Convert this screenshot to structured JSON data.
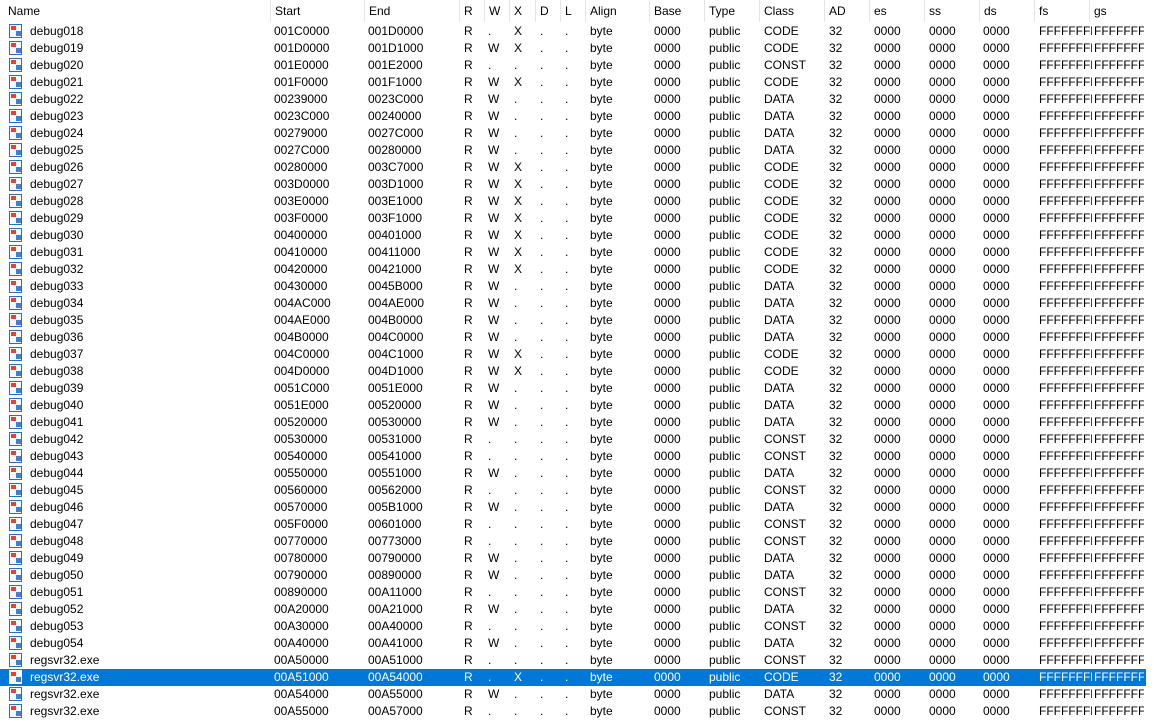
{
  "columns": [
    "Name",
    "Start",
    "End",
    "R",
    "W",
    "X",
    "D",
    "L",
    "Align",
    "Base",
    "Type",
    "Class",
    "AD",
    "es",
    "ss",
    "ds",
    "fs",
    "gs"
  ],
  "selected_index": 38,
  "colors": {
    "selection": "#0078d7",
    "icon_accent": "#e8402c"
  },
  "icons": {
    "segment": "segment-icon"
  },
  "rows": [
    [
      "debug018",
      "001C0000",
      "001D0000",
      "R",
      ".",
      "X",
      ".",
      ".",
      "byte",
      "0000",
      "public",
      "CODE",
      "32",
      "0000",
      "0000",
      "0000",
      "FFFFFFFF",
      "FFFFFFFF"
    ],
    [
      "debug019",
      "001D0000",
      "001D1000",
      "R",
      "W",
      "X",
      ".",
      ".",
      "byte",
      "0000",
      "public",
      "CODE",
      "32",
      "0000",
      "0000",
      "0000",
      "FFFFFFFF",
      "FFFFFFFF"
    ],
    [
      "debug020",
      "001E0000",
      "001E2000",
      "R",
      ".",
      ".",
      ".",
      ".",
      "byte",
      "0000",
      "public",
      "CONST",
      "32",
      "0000",
      "0000",
      "0000",
      "FFFFFFFF",
      "FFFFFFFF"
    ],
    [
      "debug021",
      "001F0000",
      "001F1000",
      "R",
      "W",
      "X",
      ".",
      ".",
      "byte",
      "0000",
      "public",
      "CODE",
      "32",
      "0000",
      "0000",
      "0000",
      "FFFFFFFF",
      "FFFFFFFF"
    ],
    [
      "debug022",
      "00239000",
      "0023C000",
      "R",
      "W",
      ".",
      ".",
      ".",
      "byte",
      "0000",
      "public",
      "DATA",
      "32",
      "0000",
      "0000",
      "0000",
      "FFFFFFFF",
      "FFFFFFFF"
    ],
    [
      "debug023",
      "0023C000",
      "00240000",
      "R",
      "W",
      ".",
      ".",
      ".",
      "byte",
      "0000",
      "public",
      "DATA",
      "32",
      "0000",
      "0000",
      "0000",
      "FFFFFFFF",
      "FFFFFFFF"
    ],
    [
      "debug024",
      "00279000",
      "0027C000",
      "R",
      "W",
      ".",
      ".",
      ".",
      "byte",
      "0000",
      "public",
      "DATA",
      "32",
      "0000",
      "0000",
      "0000",
      "FFFFFFFF",
      "FFFFFFFF"
    ],
    [
      "debug025",
      "0027C000",
      "00280000",
      "R",
      "W",
      ".",
      ".",
      ".",
      "byte",
      "0000",
      "public",
      "DATA",
      "32",
      "0000",
      "0000",
      "0000",
      "FFFFFFFF",
      "FFFFFFFF"
    ],
    [
      "debug026",
      "00280000",
      "003C7000",
      "R",
      "W",
      "X",
      ".",
      ".",
      "byte",
      "0000",
      "public",
      "CODE",
      "32",
      "0000",
      "0000",
      "0000",
      "FFFFFFFF",
      "FFFFFFFF"
    ],
    [
      "debug027",
      "003D0000",
      "003D1000",
      "R",
      "W",
      "X",
      ".",
      ".",
      "byte",
      "0000",
      "public",
      "CODE",
      "32",
      "0000",
      "0000",
      "0000",
      "FFFFFFFF",
      "FFFFFFFF"
    ],
    [
      "debug028",
      "003E0000",
      "003E1000",
      "R",
      "W",
      "X",
      ".",
      ".",
      "byte",
      "0000",
      "public",
      "CODE",
      "32",
      "0000",
      "0000",
      "0000",
      "FFFFFFFF",
      "FFFFFFFF"
    ],
    [
      "debug029",
      "003F0000",
      "003F1000",
      "R",
      "W",
      "X",
      ".",
      ".",
      "byte",
      "0000",
      "public",
      "CODE",
      "32",
      "0000",
      "0000",
      "0000",
      "FFFFFFFF",
      "FFFFFFFF"
    ],
    [
      "debug030",
      "00400000",
      "00401000",
      "R",
      "W",
      "X",
      ".",
      ".",
      "byte",
      "0000",
      "public",
      "CODE",
      "32",
      "0000",
      "0000",
      "0000",
      "FFFFFFFF",
      "FFFFFFFF"
    ],
    [
      "debug031",
      "00410000",
      "00411000",
      "R",
      "W",
      "X",
      ".",
      ".",
      "byte",
      "0000",
      "public",
      "CODE",
      "32",
      "0000",
      "0000",
      "0000",
      "FFFFFFFF",
      "FFFFFFFF"
    ],
    [
      "debug032",
      "00420000",
      "00421000",
      "R",
      "W",
      "X",
      ".",
      ".",
      "byte",
      "0000",
      "public",
      "CODE",
      "32",
      "0000",
      "0000",
      "0000",
      "FFFFFFFF",
      "FFFFFFFF"
    ],
    [
      "debug033",
      "00430000",
      "0045B000",
      "R",
      "W",
      ".",
      ".",
      ".",
      "byte",
      "0000",
      "public",
      "DATA",
      "32",
      "0000",
      "0000",
      "0000",
      "FFFFFFFF",
      "FFFFFFFF"
    ],
    [
      "debug034",
      "004AC000",
      "004AE000",
      "R",
      "W",
      ".",
      ".",
      ".",
      "byte",
      "0000",
      "public",
      "DATA",
      "32",
      "0000",
      "0000",
      "0000",
      "FFFFFFFF",
      "FFFFFFFF"
    ],
    [
      "debug035",
      "004AE000",
      "004B0000",
      "R",
      "W",
      ".",
      ".",
      ".",
      "byte",
      "0000",
      "public",
      "DATA",
      "32",
      "0000",
      "0000",
      "0000",
      "FFFFFFFF",
      "FFFFFFFF"
    ],
    [
      "debug036",
      "004B0000",
      "004C0000",
      "R",
      "W",
      ".",
      ".",
      ".",
      "byte",
      "0000",
      "public",
      "DATA",
      "32",
      "0000",
      "0000",
      "0000",
      "FFFFFFFF",
      "FFFFFFFF"
    ],
    [
      "debug037",
      "004C0000",
      "004C1000",
      "R",
      "W",
      "X",
      ".",
      ".",
      "byte",
      "0000",
      "public",
      "CODE",
      "32",
      "0000",
      "0000",
      "0000",
      "FFFFFFFF",
      "FFFFFFFF"
    ],
    [
      "debug038",
      "004D0000",
      "004D1000",
      "R",
      "W",
      "X",
      ".",
      ".",
      "byte",
      "0000",
      "public",
      "CODE",
      "32",
      "0000",
      "0000",
      "0000",
      "FFFFFFFF",
      "FFFFFFFF"
    ],
    [
      "debug039",
      "0051C000",
      "0051E000",
      "R",
      "W",
      ".",
      ".",
      ".",
      "byte",
      "0000",
      "public",
      "DATA",
      "32",
      "0000",
      "0000",
      "0000",
      "FFFFFFFF",
      "FFFFFFFF"
    ],
    [
      "debug040",
      "0051E000",
      "00520000",
      "R",
      "W",
      ".",
      ".",
      ".",
      "byte",
      "0000",
      "public",
      "DATA",
      "32",
      "0000",
      "0000",
      "0000",
      "FFFFFFFF",
      "FFFFFFFF"
    ],
    [
      "debug041",
      "00520000",
      "00530000",
      "R",
      "W",
      ".",
      ".",
      ".",
      "byte",
      "0000",
      "public",
      "DATA",
      "32",
      "0000",
      "0000",
      "0000",
      "FFFFFFFF",
      "FFFFFFFF"
    ],
    [
      "debug042",
      "00530000",
      "00531000",
      "R",
      ".",
      ".",
      ".",
      ".",
      "byte",
      "0000",
      "public",
      "CONST",
      "32",
      "0000",
      "0000",
      "0000",
      "FFFFFFFF",
      "FFFFFFFF"
    ],
    [
      "debug043",
      "00540000",
      "00541000",
      "R",
      ".",
      ".",
      ".",
      ".",
      "byte",
      "0000",
      "public",
      "CONST",
      "32",
      "0000",
      "0000",
      "0000",
      "FFFFFFFF",
      "FFFFFFFF"
    ],
    [
      "debug044",
      "00550000",
      "00551000",
      "R",
      "W",
      ".",
      ".",
      ".",
      "byte",
      "0000",
      "public",
      "DATA",
      "32",
      "0000",
      "0000",
      "0000",
      "FFFFFFFF",
      "FFFFFFFF"
    ],
    [
      "debug045",
      "00560000",
      "00562000",
      "R",
      ".",
      ".",
      ".",
      ".",
      "byte",
      "0000",
      "public",
      "CONST",
      "32",
      "0000",
      "0000",
      "0000",
      "FFFFFFFF",
      "FFFFFFFF"
    ],
    [
      "debug046",
      "00570000",
      "005B1000",
      "R",
      "W",
      ".",
      ".",
      ".",
      "byte",
      "0000",
      "public",
      "DATA",
      "32",
      "0000",
      "0000",
      "0000",
      "FFFFFFFF",
      "FFFFFFFF"
    ],
    [
      "debug047",
      "005F0000",
      "00601000",
      "R",
      ".",
      ".",
      ".",
      ".",
      "byte",
      "0000",
      "public",
      "CONST",
      "32",
      "0000",
      "0000",
      "0000",
      "FFFFFFFF",
      "FFFFFFFF"
    ],
    [
      "debug048",
      "00770000",
      "00773000",
      "R",
      ".",
      ".",
      ".",
      ".",
      "byte",
      "0000",
      "public",
      "CONST",
      "32",
      "0000",
      "0000",
      "0000",
      "FFFFFFFF",
      "FFFFFFFF"
    ],
    [
      "debug049",
      "00780000",
      "00790000",
      "R",
      "W",
      ".",
      ".",
      ".",
      "byte",
      "0000",
      "public",
      "DATA",
      "32",
      "0000",
      "0000",
      "0000",
      "FFFFFFFF",
      "FFFFFFFF"
    ],
    [
      "debug050",
      "00790000",
      "00890000",
      "R",
      "W",
      ".",
      ".",
      ".",
      "byte",
      "0000",
      "public",
      "DATA",
      "32",
      "0000",
      "0000",
      "0000",
      "FFFFFFFF",
      "FFFFFFFF"
    ],
    [
      "debug051",
      "00890000",
      "00A11000",
      "R",
      ".",
      ".",
      ".",
      ".",
      "byte",
      "0000",
      "public",
      "CONST",
      "32",
      "0000",
      "0000",
      "0000",
      "FFFFFFFF",
      "FFFFFFFF"
    ],
    [
      "debug052",
      "00A20000",
      "00A21000",
      "R",
      "W",
      ".",
      ".",
      ".",
      "byte",
      "0000",
      "public",
      "DATA",
      "32",
      "0000",
      "0000",
      "0000",
      "FFFFFFFF",
      "FFFFFFFF"
    ],
    [
      "debug053",
      "00A30000",
      "00A40000",
      "R",
      ".",
      ".",
      ".",
      ".",
      "byte",
      "0000",
      "public",
      "CONST",
      "32",
      "0000",
      "0000",
      "0000",
      "FFFFFFFF",
      "FFFFFFFF"
    ],
    [
      "debug054",
      "00A40000",
      "00A41000",
      "R",
      "W",
      ".",
      ".",
      ".",
      "byte",
      "0000",
      "public",
      "DATA",
      "32",
      "0000",
      "0000",
      "0000",
      "FFFFFFFF",
      "FFFFFFFF"
    ],
    [
      "regsvr32.exe",
      "00A50000",
      "00A51000",
      "R",
      ".",
      ".",
      ".",
      ".",
      "byte",
      "0000",
      "public",
      "CONST",
      "32",
      "0000",
      "0000",
      "0000",
      "FFFFFFFF",
      "FFFFFFFF"
    ],
    [
      "regsvr32.exe",
      "00A51000",
      "00A54000",
      "R",
      ".",
      "X",
      ".",
      ".",
      "byte",
      "0000",
      "public",
      "CODE",
      "32",
      "0000",
      "0000",
      "0000",
      "FFFFFFFF",
      "FFFFFFFF"
    ],
    [
      "regsvr32.exe",
      "00A54000",
      "00A55000",
      "R",
      "W",
      ".",
      ".",
      ".",
      "byte",
      "0000",
      "public",
      "DATA",
      "32",
      "0000",
      "0000",
      "0000",
      "FFFFFFFF",
      "FFFFFFFF"
    ],
    [
      "regsvr32.exe",
      "00A55000",
      "00A57000",
      "R",
      ".",
      ".",
      ".",
      ".",
      "byte",
      "0000",
      "public",
      "CONST",
      "32",
      "0000",
      "0000",
      "0000",
      "FFFFFFFF",
      "FFFFFFFF"
    ]
  ]
}
